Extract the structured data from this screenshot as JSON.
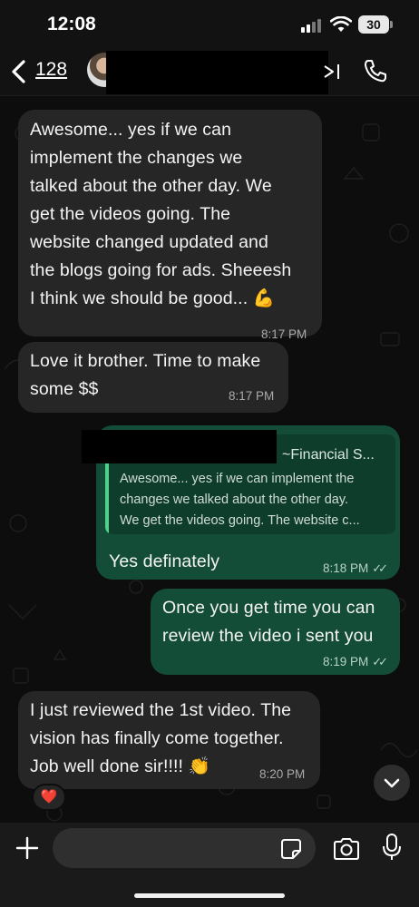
{
  "status": {
    "time": "12:08",
    "battery": "30"
  },
  "header": {
    "back_count": "128",
    "contact_name": ""
  },
  "messages": [
    {
      "direction": "in",
      "text": [
        "Awesome... yes if we can",
        "implement the changes we",
        "talked about the other day. We",
        "get the videos going. The",
        "website changed updated and",
        "the blogs going for ads. Sheeesh",
        "I think we should be good... 💪"
      ],
      "time": "8:17 PM"
    },
    {
      "direction": "in",
      "text": [
        "Love it brother. Time to make",
        "some $$"
      ],
      "time": "8:17 PM"
    },
    {
      "direction": "out",
      "reply": {
        "author": "~Financial S...",
        "text": [
          "Awesome... yes if we can implement the",
          "changes we talked about the other day.",
          "We get the videos going. The website c..."
        ]
      },
      "text": [
        "Yes definately"
      ],
      "time": "8:18 PM"
    },
    {
      "direction": "out",
      "text": [
        "Once you get time you can",
        "review the video i sent you"
      ],
      "time": "8:19 PM"
    },
    {
      "direction": "in",
      "text": [
        "I just reviewed the 1st video. The",
        "vision has finally come together.",
        "Job well done sir!!!! 👏"
      ],
      "time": "8:20 PM",
      "reaction": "❤️"
    }
  ],
  "input": {
    "placeholder": ""
  },
  "icons": {
    "back": "chevron-left-icon",
    "video": "video-camera-icon",
    "call": "phone-icon",
    "attach": "plus-icon",
    "sticker": "sticker-icon",
    "camera": "camera-icon",
    "mic": "microphone-icon",
    "scroll": "chevron-down-icon"
  },
  "colors": {
    "incoming_bubble": "#262626",
    "outgoing_bubble": "#144d37",
    "accent": "#4fd18b",
    "background": "#0d0d0d"
  }
}
